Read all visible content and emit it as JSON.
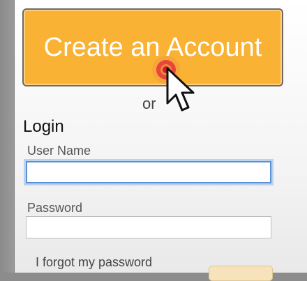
{
  "create_account": {
    "label": "Create an Account"
  },
  "separator": {
    "text": "or"
  },
  "login": {
    "heading": "Login",
    "username_label": "User Name",
    "username_value": "",
    "password_label": "Password",
    "password_value": "",
    "forgot_link": "I forgot my password"
  },
  "colors": {
    "accent": "#f9b233",
    "focus_ring": "#5b8fd6",
    "click_indicator": "#e8463a"
  },
  "icons": {
    "cursor": "arrow-pointer",
    "click": "click-indicator"
  }
}
